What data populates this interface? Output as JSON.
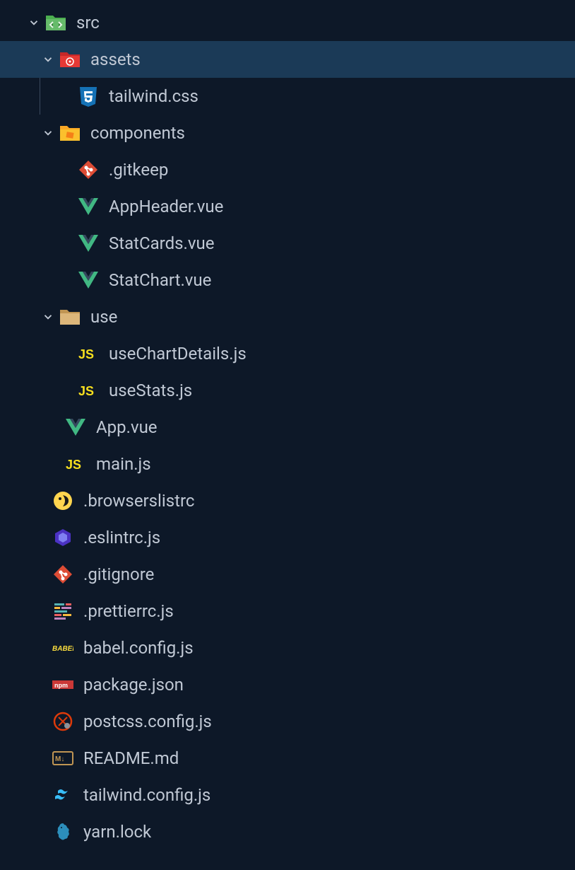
{
  "tree": {
    "src": {
      "label": "src",
      "expanded": true,
      "children": {
        "assets": {
          "label": "assets",
          "expanded": true,
          "selected": true,
          "children": {
            "tailwindcss": {
              "label": "tailwind.css"
            }
          }
        },
        "components": {
          "label": "components",
          "expanded": true,
          "children": {
            "gitkeep": {
              "label": ".gitkeep"
            },
            "appheader": {
              "label": "AppHeader.vue"
            },
            "statcards": {
              "label": "StatCards.vue"
            },
            "statchart": {
              "label": "StatChart.vue"
            }
          }
        },
        "use": {
          "label": "use",
          "expanded": true,
          "children": {
            "usechartdetails": {
              "label": "useChartDetails.js"
            },
            "usestats": {
              "label": "useStats.js"
            }
          }
        },
        "appvue": {
          "label": "App.vue"
        },
        "mainjs": {
          "label": "main.js"
        }
      }
    },
    "browserslistrc": {
      "label": ".browserslistrc"
    },
    "eslintrc": {
      "label": ".eslintrc.js"
    },
    "gitignore": {
      "label": ".gitignore"
    },
    "prettierrc": {
      "label": ".prettierrc.js"
    },
    "babelconfig": {
      "label": "babel.config.js"
    },
    "packagejson": {
      "label": "package.json"
    },
    "postcssconfig": {
      "label": "postcss.config.js"
    },
    "readme": {
      "label": "README.md"
    },
    "tailwindconfig": {
      "label": "tailwind.config.js"
    },
    "yarnlock": {
      "label": "yarn.lock"
    }
  }
}
